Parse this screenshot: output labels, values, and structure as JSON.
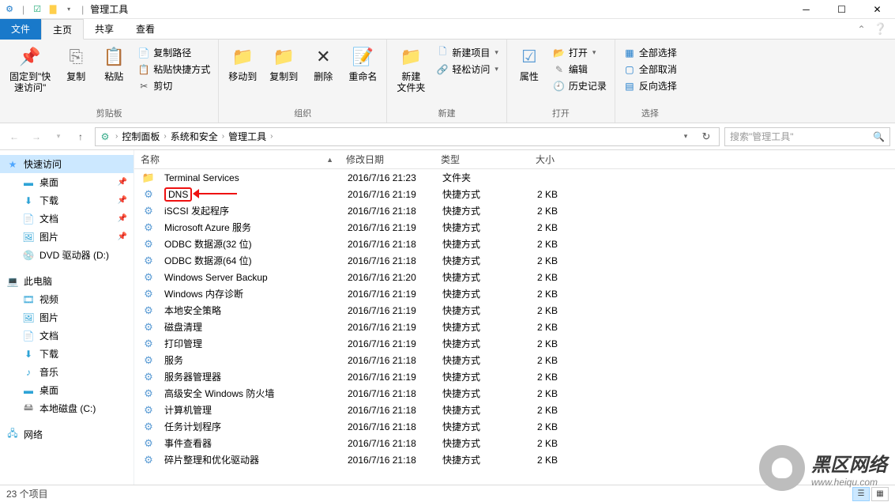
{
  "window": {
    "title": "管理工具",
    "file_tab": "文件",
    "tabs": [
      "主页",
      "共享",
      "查看"
    ]
  },
  "ribbon": {
    "groups": {
      "clipboard": {
        "pin": "固定到\"快\n速访问\"",
        "copy": "复制",
        "paste": "粘贴",
        "copy_path": "复制路径",
        "paste_shortcut": "粘贴快捷方式",
        "cut": "剪切",
        "label": "剪贴板"
      },
      "organize": {
        "move_to": "移动到",
        "copy_to": "复制到",
        "delete": "删除",
        "rename": "重命名",
        "label": "组织"
      },
      "new": {
        "new_folder": "新建\n文件夹",
        "new_item": "新建项目",
        "easy_access": "轻松访问",
        "label": "新建"
      },
      "open": {
        "properties": "属性",
        "open": "打开",
        "edit": "编辑",
        "history": "历史记录",
        "label": "打开"
      },
      "select": {
        "select_all": "全部选择",
        "select_none": "全部取消",
        "invert": "反向选择",
        "label": "选择"
      }
    }
  },
  "breadcrumbs": [
    "控制面板",
    "系统和安全",
    "管理工具"
  ],
  "search": {
    "placeholder": "搜索\"管理工具\""
  },
  "nav_pane": {
    "quick_access": "快速访问",
    "desktop": "桌面",
    "downloads": "下载",
    "documents": "文档",
    "pictures": "图片",
    "dvd_drive": "DVD 驱动器 (D:)",
    "this_pc": "此电脑",
    "videos": "视频",
    "pictures2": "图片",
    "documents2": "文档",
    "downloads2": "下载",
    "music": "音乐",
    "desktop2": "桌面",
    "local_disk": "本地磁盘 (C:)",
    "network": "网络"
  },
  "columns": {
    "name": "名称",
    "date": "修改日期",
    "type": "类型",
    "size": "大小"
  },
  "files": [
    {
      "name": "Terminal Services",
      "date": "2016/7/16 21:23",
      "type": "文件夹",
      "size": ""
    },
    {
      "name": "DNS",
      "date": "2016/7/16 21:19",
      "type": "快捷方式",
      "size": "2 KB",
      "hl": true
    },
    {
      "name": "iSCSI 发起程序",
      "date": "2016/7/16 21:18",
      "type": "快捷方式",
      "size": "2 KB"
    },
    {
      "name": "Microsoft Azure 服务",
      "date": "2016/7/16 21:19",
      "type": "快捷方式",
      "size": "2 KB"
    },
    {
      "name": "ODBC 数据源(32 位)",
      "date": "2016/7/16 21:18",
      "type": "快捷方式",
      "size": "2 KB"
    },
    {
      "name": "ODBC 数据源(64 位)",
      "date": "2016/7/16 21:18",
      "type": "快捷方式",
      "size": "2 KB"
    },
    {
      "name": "Windows Server Backup",
      "date": "2016/7/16 21:20",
      "type": "快捷方式",
      "size": "2 KB"
    },
    {
      "name": "Windows 内存诊断",
      "date": "2016/7/16 21:19",
      "type": "快捷方式",
      "size": "2 KB"
    },
    {
      "name": "本地安全策略",
      "date": "2016/7/16 21:19",
      "type": "快捷方式",
      "size": "2 KB"
    },
    {
      "name": "磁盘清理",
      "date": "2016/7/16 21:19",
      "type": "快捷方式",
      "size": "2 KB"
    },
    {
      "name": "打印管理",
      "date": "2016/7/16 21:19",
      "type": "快捷方式",
      "size": "2 KB"
    },
    {
      "name": "服务",
      "date": "2016/7/16 21:18",
      "type": "快捷方式",
      "size": "2 KB"
    },
    {
      "name": "服务器管理器",
      "date": "2016/7/16 21:19",
      "type": "快捷方式",
      "size": "2 KB"
    },
    {
      "name": "高级安全 Windows 防火墙",
      "date": "2016/7/16 21:18",
      "type": "快捷方式",
      "size": "2 KB"
    },
    {
      "name": "计算机管理",
      "date": "2016/7/16 21:18",
      "type": "快捷方式",
      "size": "2 KB"
    },
    {
      "name": "任务计划程序",
      "date": "2016/7/16 21:18",
      "type": "快捷方式",
      "size": "2 KB"
    },
    {
      "name": "事件查看器",
      "date": "2016/7/16 21:18",
      "type": "快捷方式",
      "size": "2 KB"
    },
    {
      "name": "碎片整理和优化驱动器",
      "date": "2016/7/16 21:18",
      "type": "快捷方式",
      "size": "2 KB"
    }
  ],
  "status": {
    "count": "23 个项目"
  },
  "watermark": {
    "main": "黑区网络",
    "sub": "www.heiqu.com"
  }
}
